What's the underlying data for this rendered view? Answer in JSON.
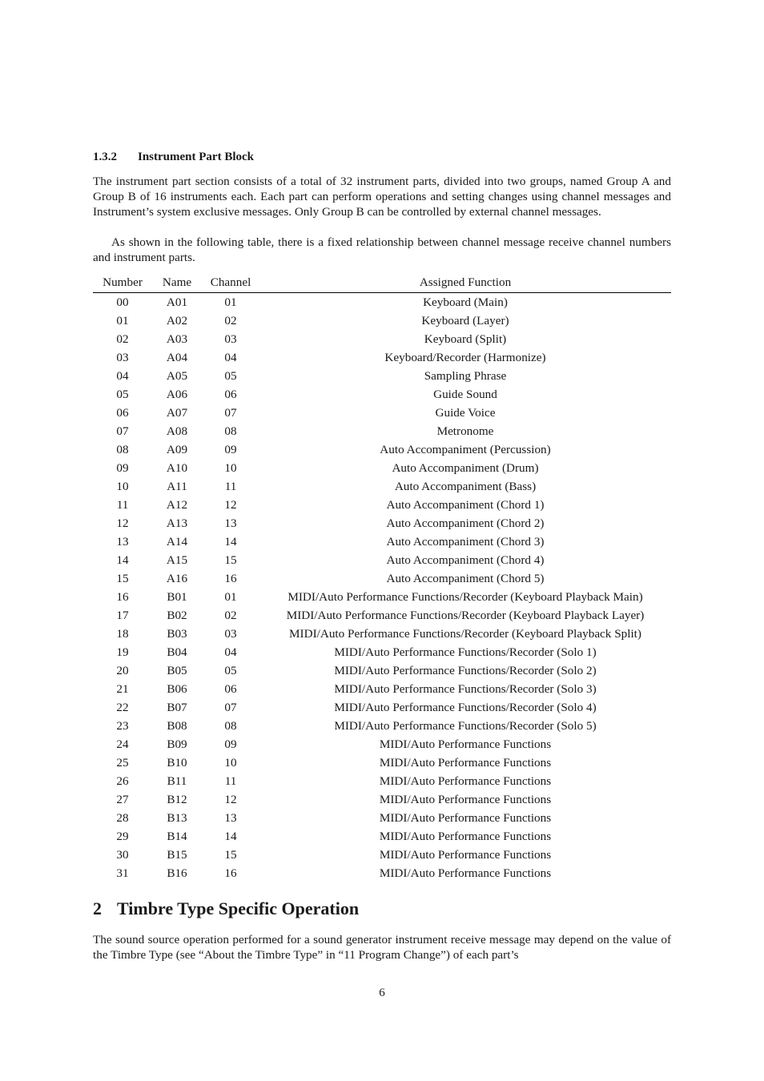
{
  "subsection": {
    "number": "1.3.2",
    "title": "Instrument Part Block"
  },
  "paragraphs": [
    "The instrument part section consists of a total of 32 instrument parts, divided into two groups, named Group A and Group B of 16 instruments each.  Each part can perform operations and setting changes using channel messages and Instrument’s system exclusive messages.  Only Group B can be controlled by external channel messages.",
    "As shown in the following table, there is a fixed relationship between channel message receive channel numbers and instrument parts."
  ],
  "table": {
    "headers": [
      "Number",
      "Name",
      "Channel",
      "Assigned Function"
    ],
    "rows": [
      [
        "00",
        "A01",
        "01",
        "Keyboard (Main)"
      ],
      [
        "01",
        "A02",
        "02",
        "Keyboard (Layer)"
      ],
      [
        "02",
        "A03",
        "03",
        "Keyboard (Split)"
      ],
      [
        "03",
        "A04",
        "04",
        "Keyboard/Recorder (Harmonize)"
      ],
      [
        "04",
        "A05",
        "05",
        "Sampling Phrase"
      ],
      [
        "05",
        "A06",
        "06",
        "Guide Sound"
      ],
      [
        "06",
        "A07",
        "07",
        "Guide Voice"
      ],
      [
        "07",
        "A08",
        "08",
        "Metronome"
      ],
      [
        "08",
        "A09",
        "09",
        "Auto Accompaniment (Percussion)"
      ],
      [
        "09",
        "A10",
        "10",
        "Auto Accompaniment (Drum)"
      ],
      [
        "10",
        "A11",
        "11",
        "Auto Accompaniment (Bass)"
      ],
      [
        "11",
        "A12",
        "12",
        "Auto Accompaniment (Chord 1)"
      ],
      [
        "12",
        "A13",
        "13",
        "Auto Accompaniment (Chord 2)"
      ],
      [
        "13",
        "A14",
        "14",
        "Auto Accompaniment (Chord 3)"
      ],
      [
        "14",
        "A15",
        "15",
        "Auto Accompaniment (Chord 4)"
      ],
      [
        "15",
        "A16",
        "16",
        "Auto Accompaniment (Chord 5)"
      ],
      [
        "16",
        "B01",
        "01",
        "MIDI/Auto Performance Functions/Recorder (Keyboard Playback Main)"
      ],
      [
        "17",
        "B02",
        "02",
        "MIDI/Auto Performance Functions/Recorder (Keyboard Playback Layer)"
      ],
      [
        "18",
        "B03",
        "03",
        "MIDI/Auto Performance Functions/Recorder (Keyboard Playback Split)"
      ],
      [
        "19",
        "B04",
        "04",
        "MIDI/Auto Performance Functions/Recorder (Solo 1)"
      ],
      [
        "20",
        "B05",
        "05",
        "MIDI/Auto Performance Functions/Recorder (Solo 2)"
      ],
      [
        "21",
        "B06",
        "06",
        "MIDI/Auto Performance Functions/Recorder (Solo 3)"
      ],
      [
        "22",
        "B07",
        "07",
        "MIDI/Auto Performance Functions/Recorder (Solo 4)"
      ],
      [
        "23",
        "B08",
        "08",
        "MIDI/Auto Performance Functions/Recorder (Solo 5)"
      ],
      [
        "24",
        "B09",
        "09",
        "MIDI/Auto Performance Functions"
      ],
      [
        "25",
        "B10",
        "10",
        "MIDI/Auto Performance Functions"
      ],
      [
        "26",
        "B11",
        "11",
        "MIDI/Auto Performance Functions"
      ],
      [
        "27",
        "B12",
        "12",
        "MIDI/Auto Performance Functions"
      ],
      [
        "28",
        "B13",
        "13",
        "MIDI/Auto Performance Functions"
      ],
      [
        "29",
        "B14",
        "14",
        "MIDI/Auto Performance Functions"
      ],
      [
        "30",
        "B15",
        "15",
        "MIDI/Auto Performance Functions"
      ],
      [
        "31",
        "B16",
        "16",
        "MIDI/Auto Performance Functions"
      ]
    ]
  },
  "section": {
    "number": "2",
    "title": "Timbre Type Specific Operation"
  },
  "section_paragraph": "The sound source operation performed for a sound generator instrument receive message may depend on the value of the Timbre Type (see “About the Timbre Type” in “11 Program Change”) of each part’s",
  "page_number": "6"
}
